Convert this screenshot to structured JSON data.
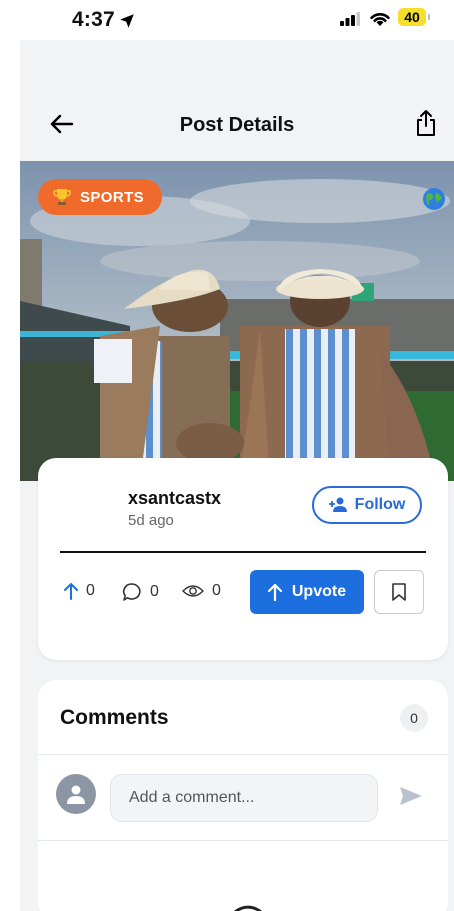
{
  "status_bar": {
    "time": "4:37",
    "battery": "40"
  },
  "header": {
    "title": "Post Details"
  },
  "post": {
    "category": "SPORTS",
    "username": "xsantcastx",
    "time_ago": "5d ago",
    "follow_label": "Follow",
    "upvotes": "0",
    "comments_count": "0",
    "views": "0",
    "upvote_label": "Upvote"
  },
  "comments": {
    "title": "Comments",
    "count": "0",
    "input_placeholder": "Add a comment..."
  },
  "colors": {
    "accent": "#1d6fe0",
    "badge": "#f06a2c"
  },
  "icons": [
    "location-arrow-icon",
    "signal-icon",
    "wifi-icon",
    "back-arrow-icon",
    "share-icon",
    "trophy-icon",
    "globe-icon",
    "add-person-icon",
    "arrow-up-icon",
    "comment-icon",
    "eye-icon",
    "bookmark-icon",
    "user-icon",
    "send-icon",
    "loading-spinner-icon"
  ]
}
